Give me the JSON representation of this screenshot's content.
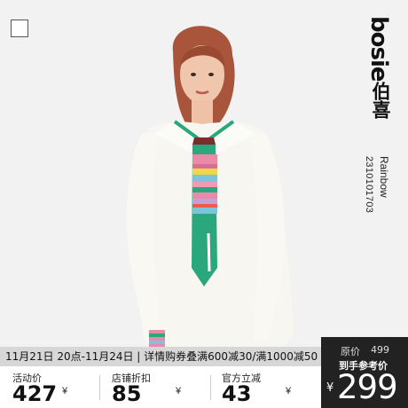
{
  "brand": {
    "name_en": "bosie",
    "name_cn": "伯喜"
  },
  "product": {
    "collection": "Rainbow",
    "code": "2310101703"
  },
  "promo": {
    "text": "11月21日 20点-11月24日 | 详情购券叠满600减30/满1000减50"
  },
  "prices": [
    {
      "label": "活动价",
      "currency": "¥",
      "value": "427"
    },
    {
      "label": "店铺折扣",
      "currency": "¥",
      "value": "85"
    },
    {
      "label": "官方立减",
      "currency": "¥",
      "value": "43"
    }
  ],
  "price_panel": {
    "original_label": "原价",
    "original_value": "499",
    "final_label": "到手参考价",
    "currency": "¥",
    "final_value": "299"
  },
  "colors": {
    "background": "#f2f2f2",
    "panel": "#222222",
    "promo_bar": "#d7d7d7",
    "tie_green": "#2aa77d",
    "tie_pink": "#e98aa8",
    "tie_yellow": "#f2d64a",
    "tie_blue": "#7cc3dc"
  },
  "icons": {
    "select": "checkbox-icon"
  }
}
